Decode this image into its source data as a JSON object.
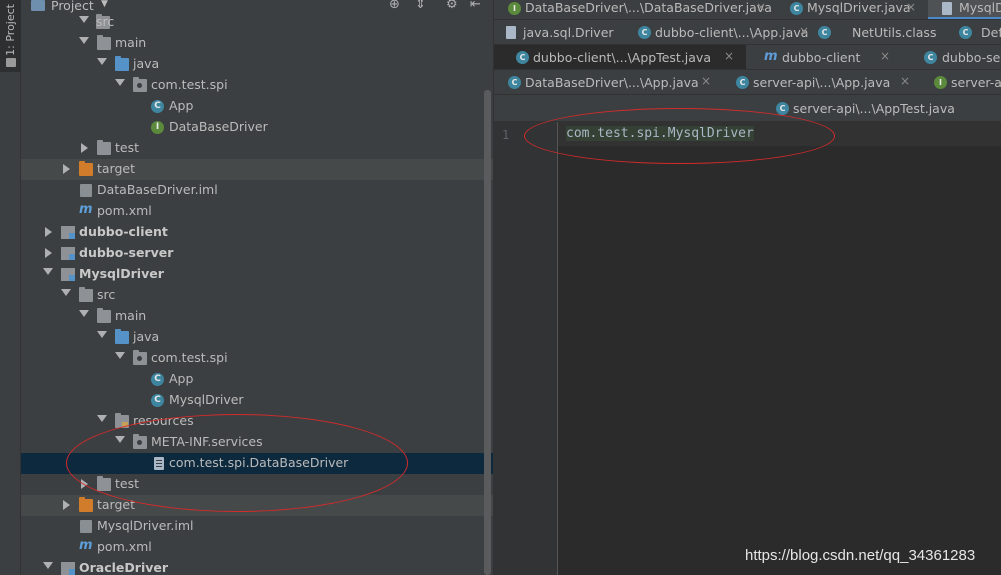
{
  "tool_window": {
    "tab_label": "1: Project"
  },
  "panel": {
    "title": "Project"
  },
  "tree": {
    "r_src1": "src",
    "r_main1": "main",
    "r_java1": "java",
    "r_pkg1": "com.test.spi",
    "r_app1": "App",
    "r_dbd1": "DataBaseDriver",
    "r_test1": "test",
    "r_target1": "target",
    "r_iml1": "DataBaseDriver.iml",
    "r_pom1": "pom.xml",
    "r_client": "dubbo-client",
    "r_server": "dubbo-server",
    "r_mysql": "MysqlDriver",
    "r_src2": "src",
    "r_main2": "main",
    "r_java2": "java",
    "r_pkg2": "com.test.spi",
    "r_app2": "App",
    "r_mysqldriver": "MysqlDriver",
    "r_resources": "resources",
    "r_metainf": "META-INF.services",
    "r_spifile": "com.test.spi.DataBaseDriver",
    "r_test2": "test",
    "r_target2": "target",
    "r_iml2": "MysqlDriver.iml",
    "r_pom2": "pom.xml",
    "r_oracle": "OracleDriver"
  },
  "tabs": {
    "row1": [
      "DataBaseDriver\\...\\DataBaseDriver.java",
      "MysqlDriver.java",
      "MysqlD"
    ],
    "row2": [
      "java.sql.Driver",
      "dubbo-client\\...\\App.java",
      "NetUtils.class",
      "Def"
    ],
    "row3": [
      "dubbo-client\\...\\AppTest.java",
      "dubbo-client",
      "dubbo-ser"
    ],
    "row4": [
      "DataBaseDriver\\...\\App.java",
      "server-api\\...\\App.java",
      "server-a"
    ],
    "row5": [
      "server-api\\...\\AppTest.java"
    ]
  },
  "editor": {
    "line_number": "1",
    "code": "com.test.spi.MysqlDriver"
  },
  "watermark": "https://blog.csdn.net/qq_34361283",
  "colors": {
    "annotation": "#d42b2b",
    "selection": "#0d293e",
    "accent": "#4a88c7"
  }
}
